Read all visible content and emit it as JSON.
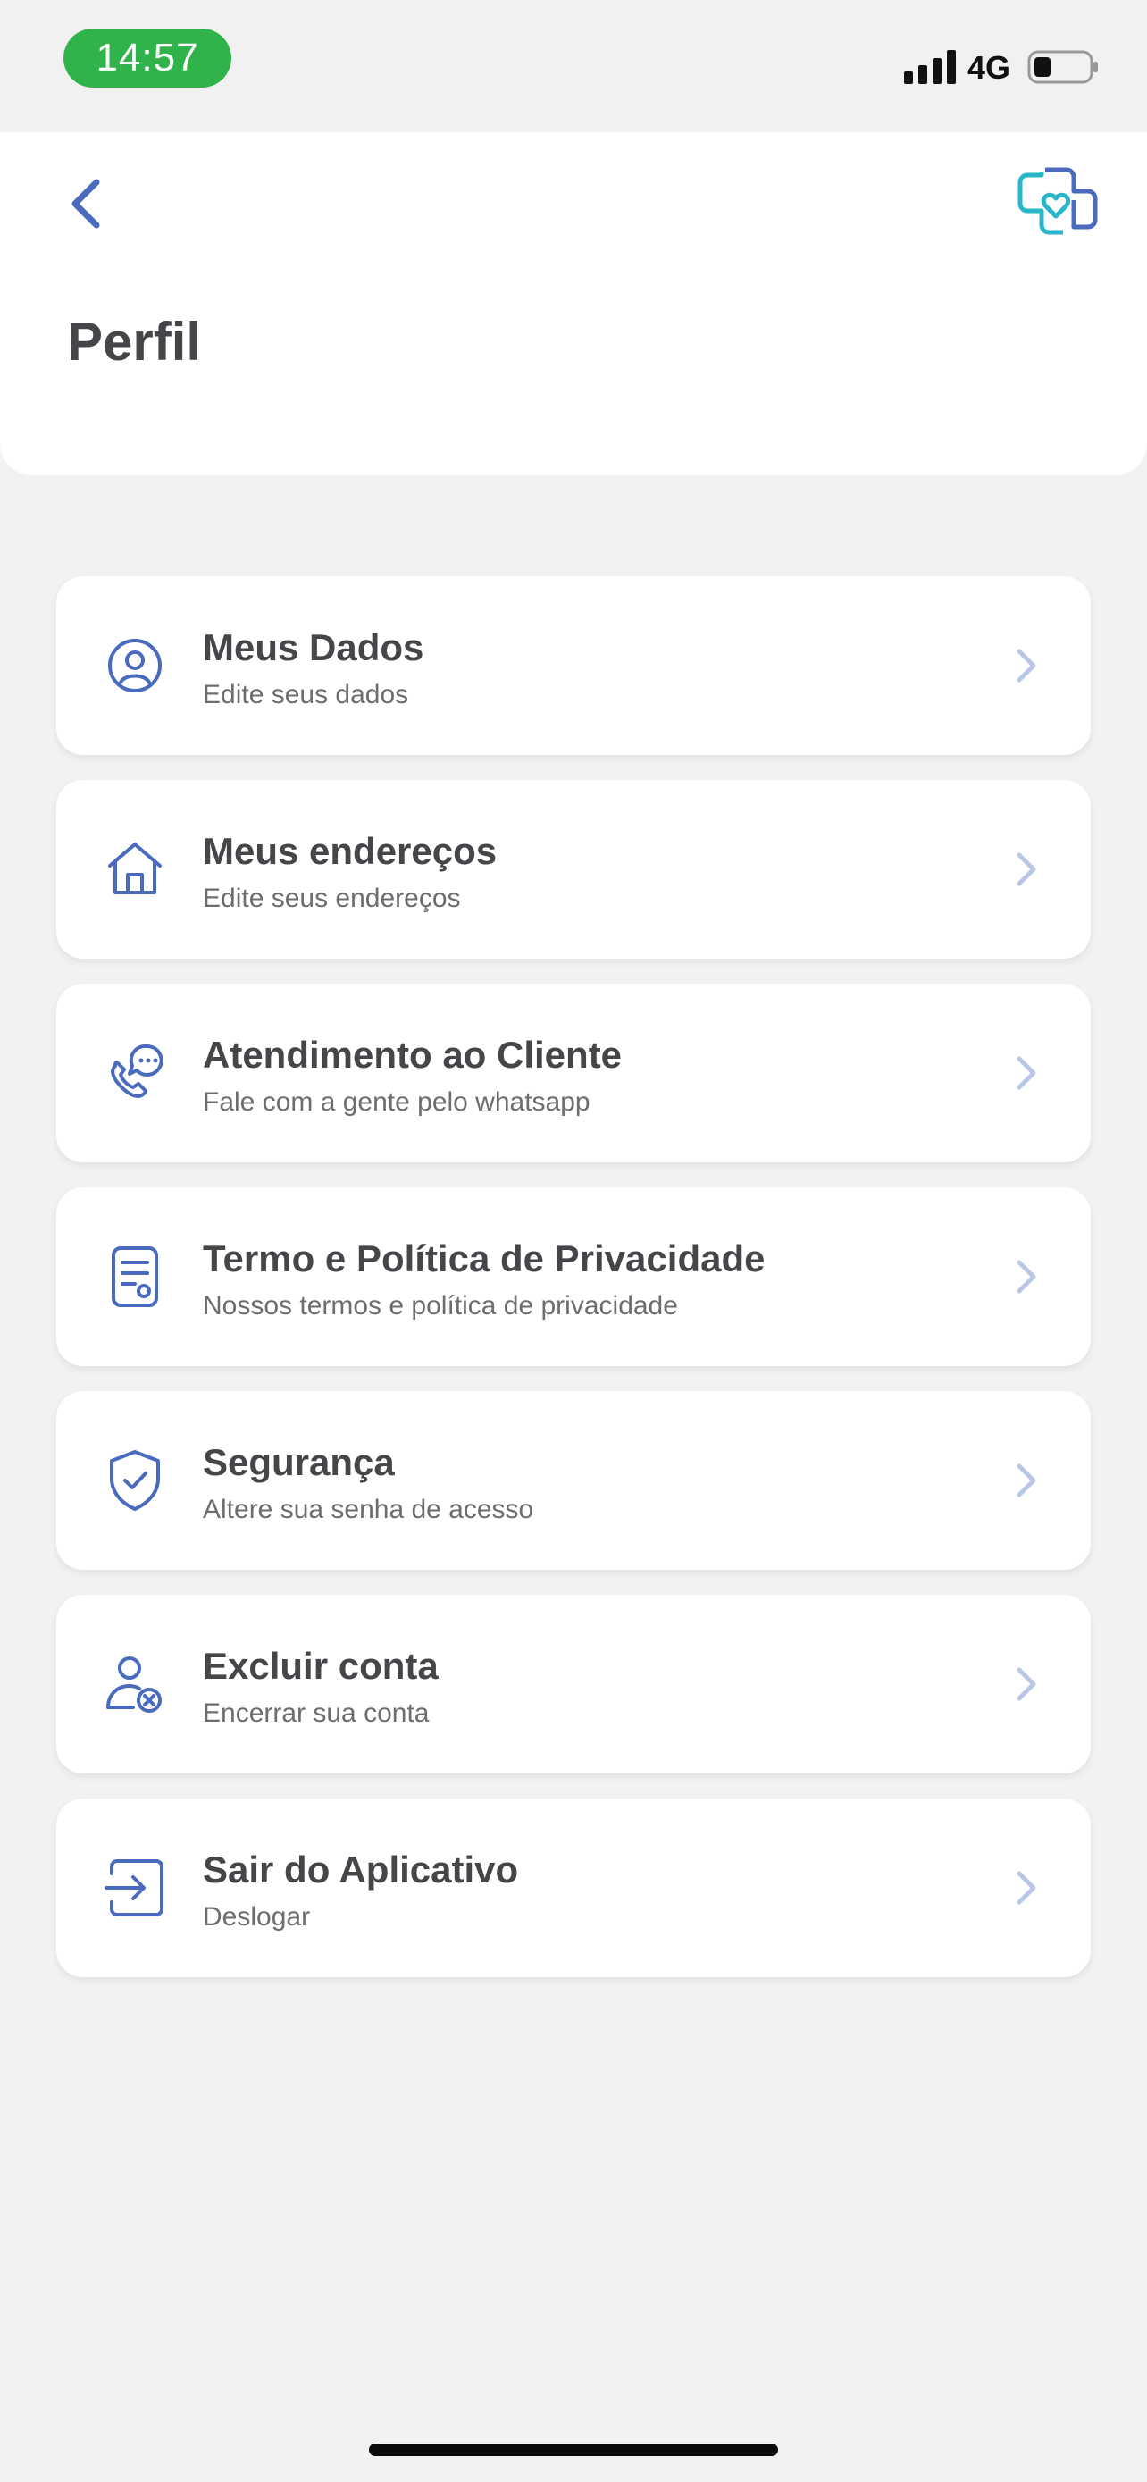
{
  "status_bar": {
    "time": "14:57",
    "network": "4G",
    "icons": [
      "signal-bars-icon",
      "battery-icon"
    ]
  },
  "header": {
    "title": "Perfil",
    "back_icon": "chevron-left-icon",
    "logo_icon": "medical-cross-logo"
  },
  "colors": {
    "accent": "#4a6bbd",
    "chevron": "#b9c6e6",
    "title_text": "#444649",
    "subtitle_text": "#6b6d70",
    "status_pill": "#31b34c",
    "logo_teal": "#29b6c9"
  },
  "menu": {
    "items": [
      {
        "title": "Meus Dados",
        "subtitle": "Edite seus dados",
        "icon": "user-circle-icon"
      },
      {
        "title": "Meus endereços",
        "subtitle": "Edite seus endereços",
        "icon": "home-icon"
      },
      {
        "title": "Atendimento ao Cliente",
        "subtitle": "Fale com a gente pelo whatsapp",
        "icon": "phone-chat-icon"
      },
      {
        "title": "Termo e Política de Privacidade",
        "subtitle": "Nossos termos e política de privacidade",
        "icon": "document-icon"
      },
      {
        "title": "Segurança",
        "subtitle": "Altere sua senha de acesso",
        "icon": "shield-check-icon"
      },
      {
        "title": "Excluir conta",
        "subtitle": "Encerrar sua conta",
        "icon": "user-remove-icon"
      },
      {
        "title": "Sair do Aplicativo",
        "subtitle": "Deslogar",
        "icon": "logout-icon"
      }
    ]
  }
}
